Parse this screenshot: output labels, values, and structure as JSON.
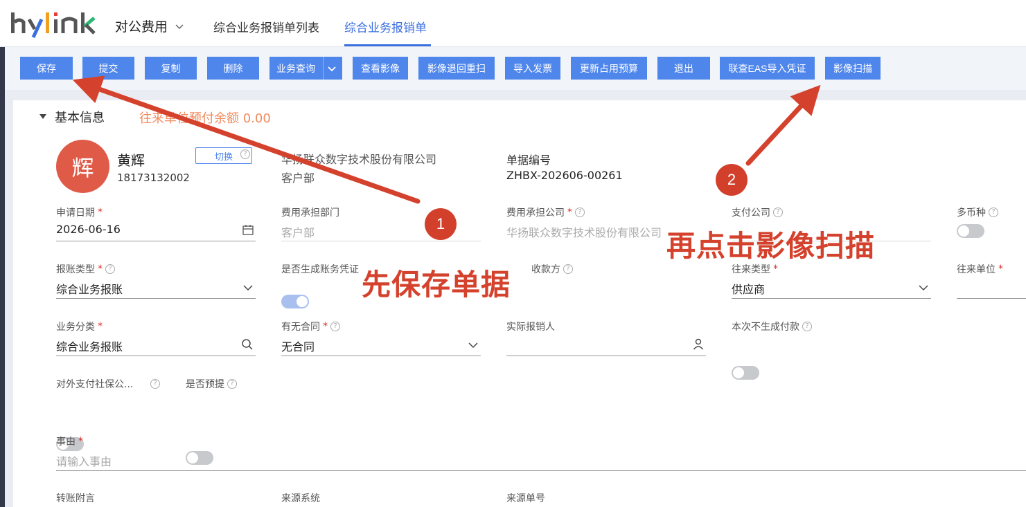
{
  "brand": {
    "logo_text": "hylink",
    "accent": "#3b6fe0",
    "button_color": "#4f86ec"
  },
  "nav": {
    "app_name": "对公费用",
    "tabs": [
      {
        "label": "综合业务报销单列表"
      },
      {
        "label": "综合业务报销单"
      }
    ]
  },
  "toolbar": {
    "buttons": [
      {
        "label": "保存"
      },
      {
        "label": "提交"
      },
      {
        "label": "复制"
      },
      {
        "label": "删除"
      },
      {
        "label": "业务查询"
      },
      {
        "label": "查看影像"
      },
      {
        "label": "影像退回重扫"
      },
      {
        "label": "导入发票"
      },
      {
        "label": "更新占用预算"
      },
      {
        "label": "退出"
      },
      {
        "label": "联查EAS导入凭证"
      },
      {
        "label": "影像扫描"
      }
    ]
  },
  "section": {
    "title": "基本信息",
    "balance_text": "往来单位预付余额 0.00"
  },
  "user": {
    "avatar_char": "辉",
    "name": "黄辉",
    "phone": "18173132002",
    "switch_label": "切换",
    "company": "华扬联众数字技术股份有限公司",
    "dept": "客户部"
  },
  "doc": {
    "label": "单据编号",
    "value": "ZHBX-202606-00261"
  },
  "fields": {
    "apply_date": {
      "label": "申请日期",
      "value": "2026-06-16"
    },
    "cost_dept": {
      "label": "费用承担部门",
      "value": "客户部"
    },
    "cost_company": {
      "label": "费用承担公司",
      "value": "华扬联众数字技术股份有限公司"
    },
    "pay_company": {
      "label": "支付公司"
    },
    "multi_currency": {
      "label": "多币种"
    },
    "reimb_type": {
      "label": "报账类型",
      "value": "综合业务报账"
    },
    "gen_voucher": {
      "label": "是否生成账务凭证"
    },
    "payee": {
      "label": "收款方"
    },
    "partner_type": {
      "label": "往来类型",
      "value": "供应商"
    },
    "partner_unit": {
      "label": "往来单位"
    },
    "biz_category": {
      "label": "业务分类",
      "value": "综合业务报账"
    },
    "contract": {
      "label": "有无合同",
      "value": "无合同"
    },
    "actual_person": {
      "label": "实际报销人"
    },
    "no_payment": {
      "label": "本次不生成付款"
    },
    "social_security": {
      "label": "对外支付社保公..."
    },
    "pre_accrual": {
      "label": "是否预提"
    },
    "reason": {
      "label": "事由",
      "placeholder": "请输入事由"
    },
    "transfer_note": {
      "label": "转账附言"
    },
    "source_system": {
      "label": "来源系统"
    },
    "source_no": {
      "label": "来源单号"
    }
  },
  "annotations": {
    "badge1": "1",
    "badge2": "2",
    "step1_text": "先保存单据",
    "step2_text": "再点击影像扫描",
    "color": "#d4422d"
  }
}
